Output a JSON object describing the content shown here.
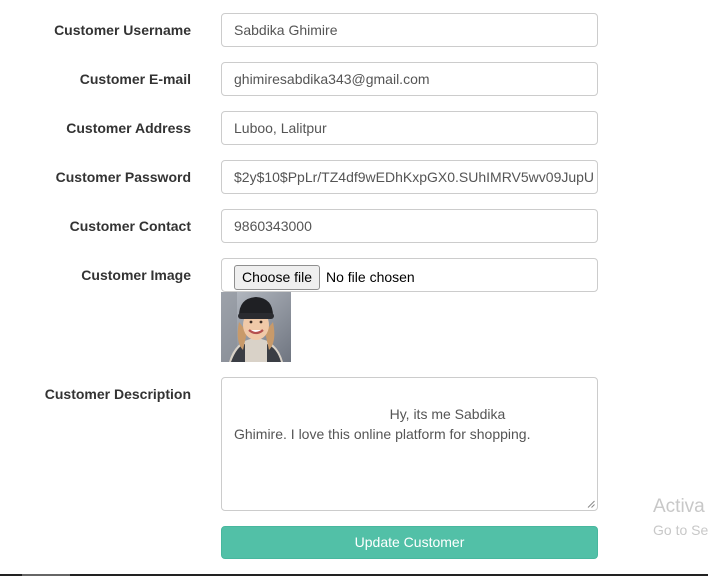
{
  "form": {
    "username": {
      "label": "Customer Username",
      "value": "Sabdika Ghimire"
    },
    "email": {
      "label": "Customer E-mail",
      "value": "ghimiresabdika343@gmail.com"
    },
    "address": {
      "label": "Customer Address",
      "value": "Luboo, Lalitpur"
    },
    "password": {
      "label": "Customer Password",
      "value": "$2y$10$PpLr/TZ4df9wEDhKxpGX0.SUhIMRV5wv09JupU"
    },
    "contact": {
      "label": "Customer Contact",
      "value": "9860343000"
    },
    "image": {
      "label": "Customer Image",
      "button": "Choose file",
      "status": "No file chosen"
    },
    "description": {
      "label": "Customer Description",
      "value": "                                    Hy, its me Sabdika\nGhimire. I love this online platform for shopping."
    },
    "submit": {
      "label": "Update Customer"
    }
  },
  "watermark": {
    "line1": "Activa",
    "line2": "Go to Se"
  },
  "colors": {
    "button": "#52c0a7",
    "border": "#cccccc"
  }
}
